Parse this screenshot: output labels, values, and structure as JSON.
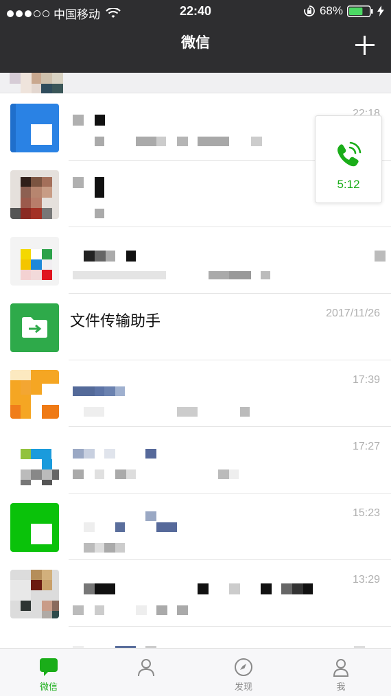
{
  "status_bar": {
    "carrier": "中国移动",
    "time": "22:40",
    "battery": "68%",
    "battery_level": 0.68
  },
  "header": {
    "title": "微信"
  },
  "chats": [
    {
      "name": "",
      "time": "22:18",
      "preview": ""
    },
    {
      "name": "",
      "time": "",
      "preview": ""
    },
    {
      "name": "",
      "time": "",
      "preview": ""
    },
    {
      "name": "文件传输助手",
      "time": "2017/11/26",
      "preview": ""
    },
    {
      "name": "",
      "time": "17:39",
      "preview": ""
    },
    {
      "name": "",
      "time": "17:27",
      "preview": ""
    },
    {
      "name": "",
      "time": "15:23",
      "preview": ""
    },
    {
      "name": "",
      "time": "13:29",
      "preview": ""
    }
  ],
  "call_float": {
    "duration": "5:12"
  },
  "tabs": [
    {
      "label": "微信"
    },
    {
      "label": ""
    },
    {
      "label": "发现"
    },
    {
      "label": "我"
    }
  ],
  "colors": {
    "header_bg": "#2e2e30",
    "accent_green": "#1aad19",
    "file_helper_green": "#2eaa4a",
    "time_gray": "#b0b0b0"
  }
}
